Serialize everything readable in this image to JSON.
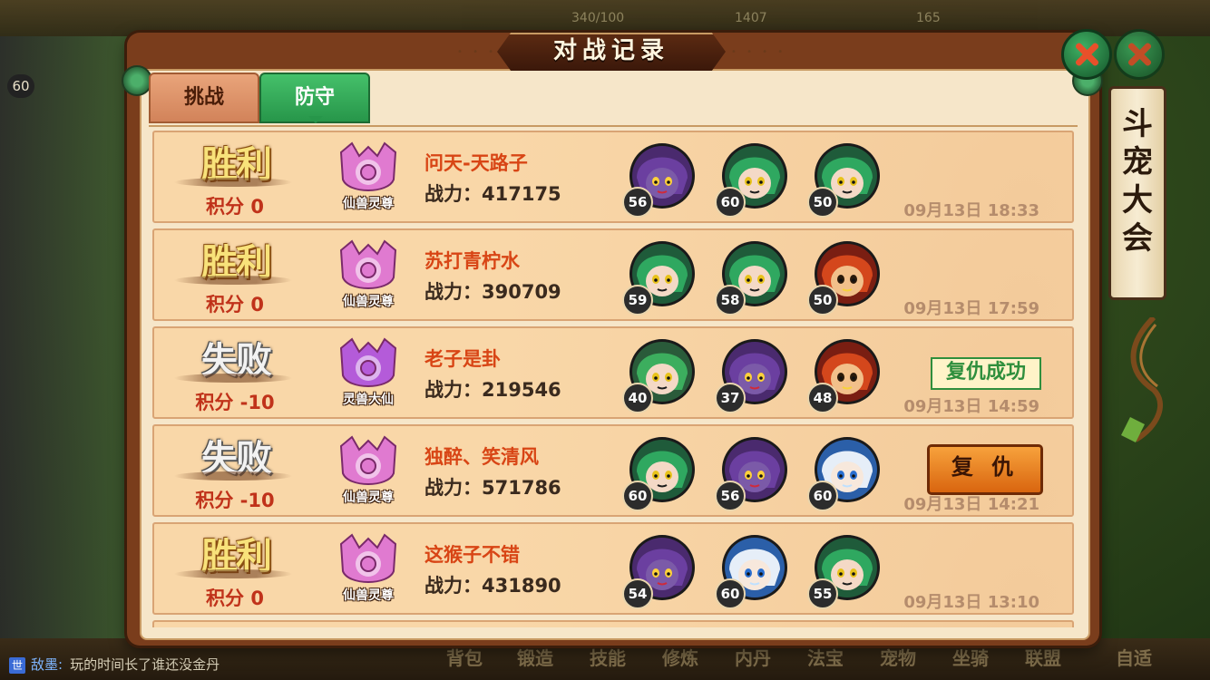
{
  "background": {
    "top_stats": [
      "340/100",
      "1407",
      "165"
    ],
    "level_badge": "60",
    "bottom_menu": [
      "背包",
      "锻造",
      "技能",
      "修炼",
      "内丹",
      "法宝",
      "宠物",
      "坐骑",
      "联盟",
      "自适"
    ],
    "chat": {
      "channel": "世",
      "sender": "敌墨:",
      "message": "玩的时间长了谁还没金丹"
    },
    "side_banner": "斗宠大会"
  },
  "dialog": {
    "title": "对战记录",
    "tabs": [
      {
        "label": "挑战",
        "active": false
      },
      {
        "label": "防守",
        "active": true
      }
    ]
  },
  "power_prefix": "战力：",
  "records": [
    {
      "result": "胜利",
      "result_type": "win",
      "score": "积分 0",
      "rank": "仙兽灵尊",
      "rank_color": "#e07ad0",
      "name": "问天-天路子",
      "power": "战力：417175",
      "pets": [
        {
          "kind": "purple-beast",
          "level": "56"
        },
        {
          "kind": "green-snake",
          "level": "60"
        },
        {
          "kind": "green-snake",
          "level": "50"
        }
      ],
      "time": "09月13日 18:33",
      "action": null
    },
    {
      "result": "胜利",
      "result_type": "win",
      "score": "积分 0",
      "rank": "仙兽灵尊",
      "rank_color": "#e07ad0",
      "name": "苏打青柠水",
      "power": "战力：390709",
      "pets": [
        {
          "kind": "green-snake",
          "level": "59"
        },
        {
          "kind": "green-snake",
          "level": "58"
        },
        {
          "kind": "red-monkey",
          "level": "50"
        }
      ],
      "time": "09月13日 17:59",
      "action": null
    },
    {
      "result": "失败",
      "result_type": "lose",
      "score": "积分 -10",
      "rank": "灵兽大仙",
      "rank_color": "#b45bd9",
      "name": "老子是卦",
      "power": "战力：219546",
      "pets": [
        {
          "kind": "green-dragon",
          "level": "40"
        },
        {
          "kind": "purple-beast",
          "level": "37"
        },
        {
          "kind": "red-monkey",
          "level": "48"
        }
      ],
      "time": "09月13日 14:59",
      "action": "复仇成功"
    },
    {
      "result": "失败",
      "result_type": "lose",
      "score": "积分 -10",
      "rank": "仙兽灵尊",
      "rank_color": "#e07ad0",
      "name": "独醉、笑清风",
      "power": "战力：571786",
      "pets": [
        {
          "kind": "green-snake",
          "level": "60"
        },
        {
          "kind": "purple-beast",
          "level": "56"
        },
        {
          "kind": "white-spirit",
          "level": "60"
        }
      ],
      "time": "09月13日 14:21",
      "action": "复 仇"
    },
    {
      "result": "胜利",
      "result_type": "win",
      "score": "积分 0",
      "rank": "仙兽灵尊",
      "rank_color": "#e07ad0",
      "name": "这猴子不错",
      "power": "战力：431890",
      "pets": [
        {
          "kind": "purple-beast",
          "level": "54"
        },
        {
          "kind": "white-spirit",
          "level": "60"
        },
        {
          "kind": "green-snake",
          "level": "55"
        }
      ],
      "time": "09月13日 13:10",
      "action": null
    }
  ]
}
